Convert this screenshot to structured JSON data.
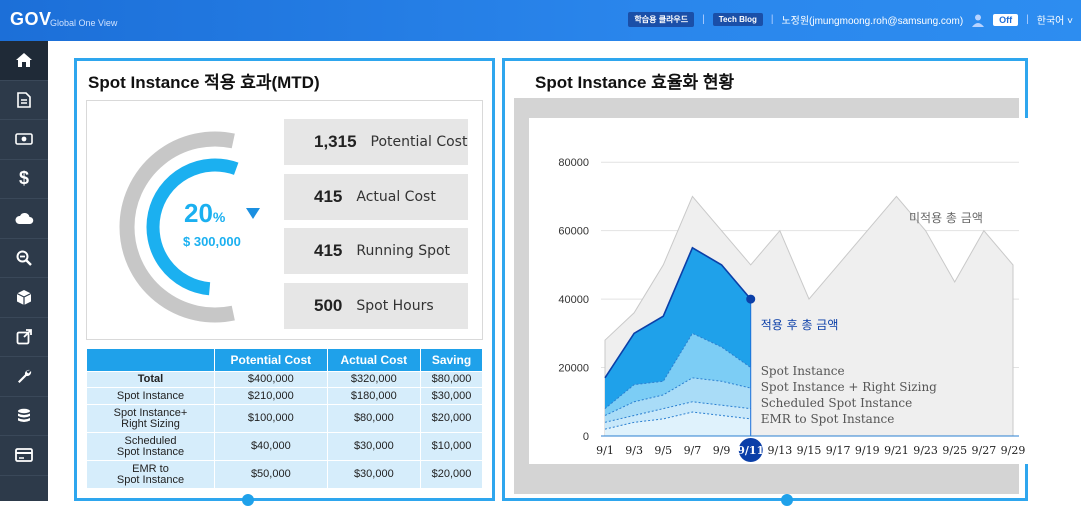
{
  "header": {
    "logo": "GOV",
    "logo_sub": "Global One View",
    "learning_cloud": "학습용 클라우드",
    "tech_blog": "Tech Blog",
    "user": "노정원(jmungmoong.roh@samsung.com)",
    "toggle": "Off",
    "language": "한국어"
  },
  "sidebar": {
    "items": [
      {
        "icon": "home-icon"
      },
      {
        "icon": "document-icon"
      },
      {
        "icon": "money-icon"
      },
      {
        "icon": "dollar-icon"
      },
      {
        "icon": "cloud-icon"
      },
      {
        "icon": "zoom-out-icon"
      },
      {
        "icon": "cube-icon"
      },
      {
        "icon": "external-link-icon"
      },
      {
        "icon": "wrench-icon"
      },
      {
        "icon": "database-icon"
      },
      {
        "icon": "card-icon"
      }
    ]
  },
  "left_panel": {
    "title": "Spot Instance 적용 효과(MTD)",
    "gauge": {
      "percent": "20",
      "percent_unit": "%",
      "amount": "$ 300,000",
      "value_fraction": 0.2
    },
    "kpis": [
      {
        "value": "1,315",
        "label": "Potential Cost"
      },
      {
        "value": "415",
        "label": "Actual Cost"
      },
      {
        "value": "415",
        "label": "Running Spot"
      },
      {
        "value": "500",
        "label": "Spot Hours"
      }
    ],
    "table": {
      "headers": [
        "",
        "Potential Cost",
        "Actual Cost",
        "Saving"
      ],
      "rows": [
        {
          "name": "Total",
          "potential": "$400,000",
          "actual": "$320,000",
          "saving": "$80,000"
        },
        {
          "name": "Spot Instance",
          "potential": "$210,000",
          "actual": "$180,000",
          "saving": "$30,000"
        },
        {
          "name": "Spot Instance+\nRight Sizing",
          "potential": "$100,000",
          "actual": "$80,000",
          "saving": "$20,000"
        },
        {
          "name": "Scheduled\nSpot Instance",
          "potential": "$40,000",
          "actual": "$30,000",
          "saving": "$10,000"
        },
        {
          "name": "EMR to\nSpot Instance",
          "potential": "$50,000",
          "actual": "$30,000",
          "saving": "$20,000"
        }
      ]
    }
  },
  "right_panel": {
    "title": "Spot Instance 효율화 현황"
  },
  "chart_data": {
    "type": "area",
    "x": [
      "9/1",
      "9/3",
      "9/5",
      "9/7",
      "9/9",
      "9/11",
      "9/13",
      "9/15",
      "9/17",
      "9/19",
      "9/21",
      "9/23",
      "9/25",
      "9/27",
      "9/29"
    ],
    "highlight_x": "9/11",
    "ylim": [
      0,
      90000
    ],
    "yticks": [
      0,
      20000,
      40000,
      60000,
      80000
    ],
    "series": [
      {
        "name": "미적용 총 금액",
        "color": "#efefef",
        "values": [
          28000,
          36000,
          50000,
          70000,
          60000,
          50000,
          60000,
          40000,
          50000,
          60000,
          70000,
          60000,
          45000,
          60000,
          50000
        ]
      },
      {
        "name": "적용 후 총 금액",
        "color": "#1fa1ea",
        "values": [
          17000,
          30000,
          35000,
          55000,
          50000,
          40000
        ]
      },
      {
        "name": "Spot Instance",
        "color": "#7ccdf5",
        "values": [
          8000,
          15000,
          16000,
          30000,
          26000,
          20000
        ]
      },
      {
        "name": "Spot Instance + Right Sizing",
        "color": "#a9dcf7",
        "values": [
          6000,
          10000,
          12000,
          17000,
          16000,
          14000
        ]
      },
      {
        "name": "Scheduled Spot Instance",
        "color": "#c8e8fa",
        "values": [
          4000,
          6000,
          8000,
          10000,
          9000,
          8000
        ]
      },
      {
        "name": "EMR to Spot Instance",
        "color": "#dff2fc",
        "values": [
          2000,
          4000,
          5000,
          7000,
          6000,
          5000
        ]
      }
    ],
    "annotations": {
      "untreated": "미적용 총 금액",
      "treated": "적용 후 총 금액"
    }
  }
}
